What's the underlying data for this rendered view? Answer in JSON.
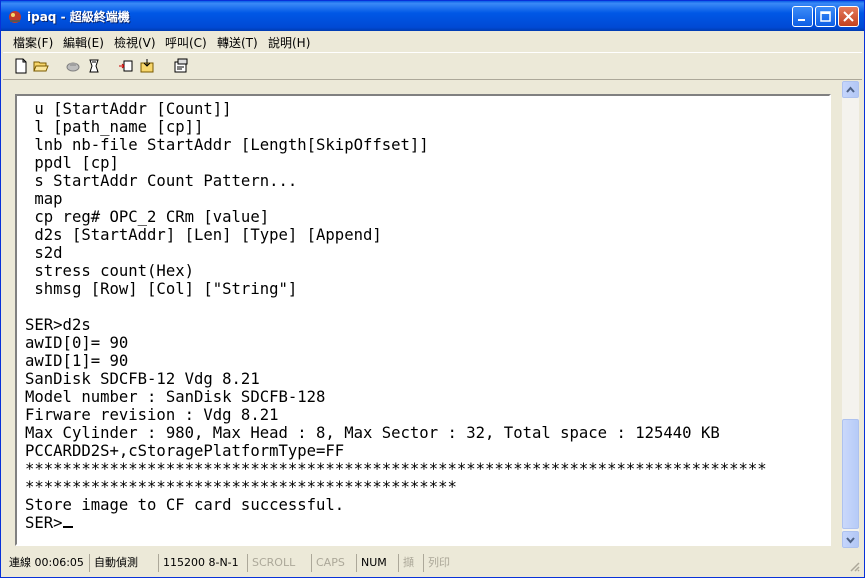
{
  "window": {
    "title": "ipaq - 超級終端機",
    "accent": "#0054e3",
    "buttons": {
      "minimize": "minimize-button",
      "maximize": "maximize-button",
      "close": "close-button"
    }
  },
  "menu": [
    {
      "label": "檔案(F)"
    },
    {
      "label": "編輯(E)"
    },
    {
      "label": "檢視(V)"
    },
    {
      "label": "呼叫(C)"
    },
    {
      "label": "轉送(T)"
    },
    {
      "label": "說明(H)"
    }
  ],
  "toolbar": {
    "icons": [
      "new-icon",
      "open-icon",
      "disconnect-icon",
      "connect-icon",
      "send-icon",
      "receive-icon",
      "properties-icon"
    ]
  },
  "terminal": {
    "lines": [
      " u [StartAddr [Count]]",
      " l [path_name [cp]]",
      " lnb nb-file StartAddr [Length[SkipOffset]]",
      " ppdl [cp]",
      " s StartAddr Count Pattern...",
      " map",
      " cp reg# OPC_2 CRm [value]",
      " d2s [StartAddr] [Len] [Type] [Append]",
      " s2d",
      " stress count(Hex)",
      " shmsg [Row] [Col] [\"String\"]",
      "",
      "SER>d2s",
      "awID[0]= 90",
      "awID[1]= 90",
      "SanDisk SDCFB-12 Vdg 8.21",
      "Model number : SanDisk SDCFB-128",
      "Firware revision : Vdg 8.21",
      "Max Cylinder : 980, Max Head : 8, Max Sector : 32, Total space : 125440 KB",
      "PCCARDD2S+,cStoragePlatformType=FF",
      "*******************************************************************************",
      "**********************************************",
      "Store image to CF card successful.",
      "SER>"
    ]
  },
  "status": {
    "connected": "連線 00:06:05",
    "detect": "自動偵測",
    "port": "115200 8-N-1",
    "scroll": "SCROLL",
    "caps": "CAPS",
    "num": "NUM",
    "capture": "擷",
    "print": "列印"
  }
}
